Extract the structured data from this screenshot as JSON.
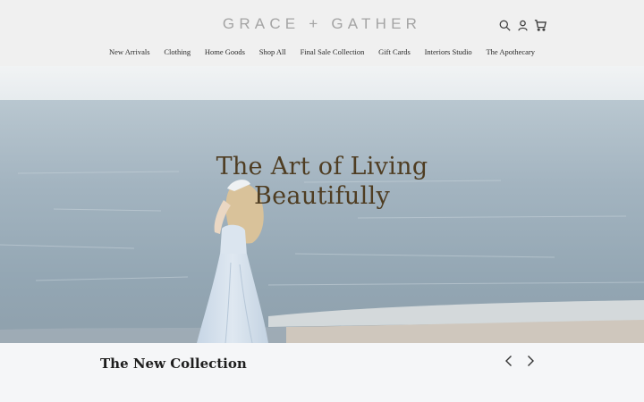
{
  "header": {
    "logo": "GRACE + GATHER",
    "icons": {
      "search": "search-icon",
      "account": "user-icon",
      "cart": "cart-icon"
    }
  },
  "nav": {
    "items": [
      "New Arrivals",
      "Clothing",
      "Home Goods",
      "Shop All",
      "Final Sale Collection",
      "Gift Cards",
      "Interiors Studio",
      "The Apothecary"
    ]
  },
  "hero": {
    "title_line1": "The Art of Living",
    "title_line2": "Beautifully",
    "title_color": "#4f3d22"
  },
  "collection": {
    "title": "The New Collection",
    "prev_icon": "chevron-left-icon",
    "next_icon": "chevron-right-icon"
  }
}
